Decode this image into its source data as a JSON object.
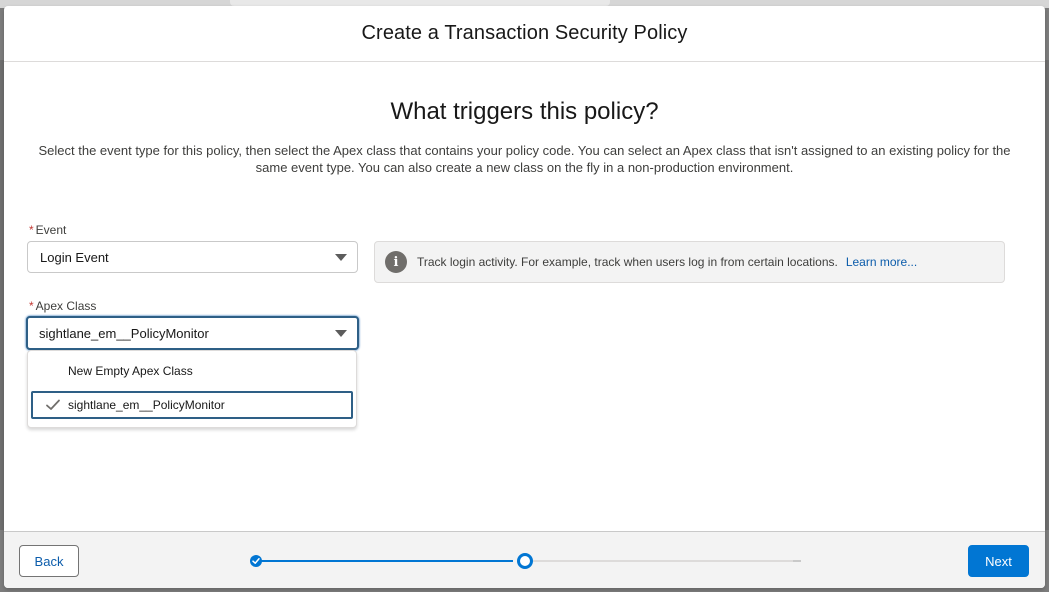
{
  "modal": {
    "title": "Create a Transaction Security Policy"
  },
  "body": {
    "heading": "What triggers this policy?",
    "description": "Select the event type for this policy, then select the Apex class that contains your policy code. You can select an Apex class that isn't assigned to an existing policy for the same event type. You can also create a new class on the fly in a non-production environment."
  },
  "event_field": {
    "required_marker": "*",
    "label": "Event",
    "value": "Login Event"
  },
  "info": {
    "icon": "info-icon",
    "text": "Track login activity. For example, track when users log in from certain locations.",
    "link": "Learn more..."
  },
  "apex_field": {
    "required_marker": "*",
    "label": "Apex Class",
    "value": "sightlane_em__PolicyMonitor",
    "options": [
      {
        "label": "New Empty Apex Class",
        "selected": false
      },
      {
        "label": "sightlane_em__PolicyMonitor",
        "selected": true
      }
    ]
  },
  "footer": {
    "back_label": "Back",
    "next_label": "Next",
    "progress": {
      "total_steps": 3,
      "current_step": 2
    }
  },
  "colors": {
    "brand": "#0176d3",
    "focus_border": "#2e5f86",
    "required": "#c23934",
    "link": "#0b5cab"
  }
}
